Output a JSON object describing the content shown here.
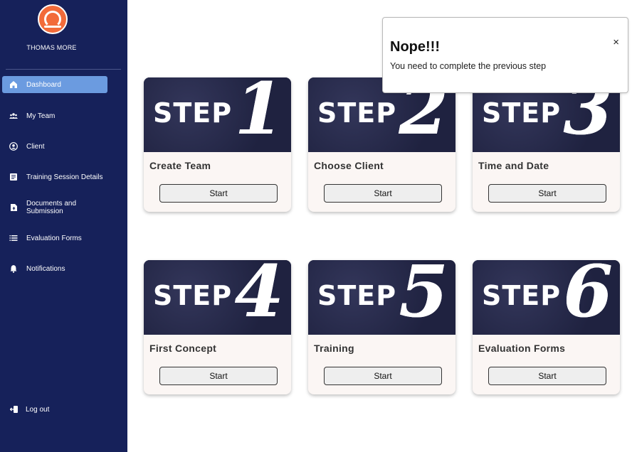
{
  "sidebar": {
    "brand": "THOMAS MORE",
    "items": [
      {
        "label": "Dashboard",
        "icon": "home-icon",
        "active": true
      },
      {
        "label": "My Team",
        "icon": "group-icon"
      },
      {
        "label": "Client",
        "icon": "user-circle-icon"
      },
      {
        "label": "Training Session Details",
        "icon": "document-list-icon"
      },
      {
        "label": "Documents and Submission",
        "icon": "file-upload-icon"
      },
      {
        "label": "Evaluation Forms",
        "icon": "list-icon"
      },
      {
        "label": "Notifications",
        "icon": "bell-icon"
      }
    ],
    "logout": {
      "label": "Log out",
      "icon": "logout-icon"
    }
  },
  "steps": [
    {
      "word": "STEP",
      "number": "1",
      "title": "Create Team",
      "button": "Start"
    },
    {
      "word": "STEP",
      "number": "2",
      "title": "Choose Client",
      "button": "Start"
    },
    {
      "word": "STEP",
      "number": "3",
      "title": "Time and Date",
      "button": "Start"
    },
    {
      "word": "STEP",
      "number": "4",
      "title": "First Concept",
      "button": "Start"
    },
    {
      "word": "STEP",
      "number": "5",
      "title": "Training",
      "button": "Start"
    },
    {
      "word": "STEP",
      "number": "6",
      "title": "Evaluation Forms",
      "button": "Start"
    }
  ],
  "toast": {
    "title": "Nope!!!",
    "message": "You need to complete the previous step",
    "close": "×"
  },
  "colors": {
    "sidebar_bg": "#16215a",
    "active_item": "#6b9be0",
    "logo": "#f26b3a",
    "card_bg": "#fbf6f4"
  }
}
